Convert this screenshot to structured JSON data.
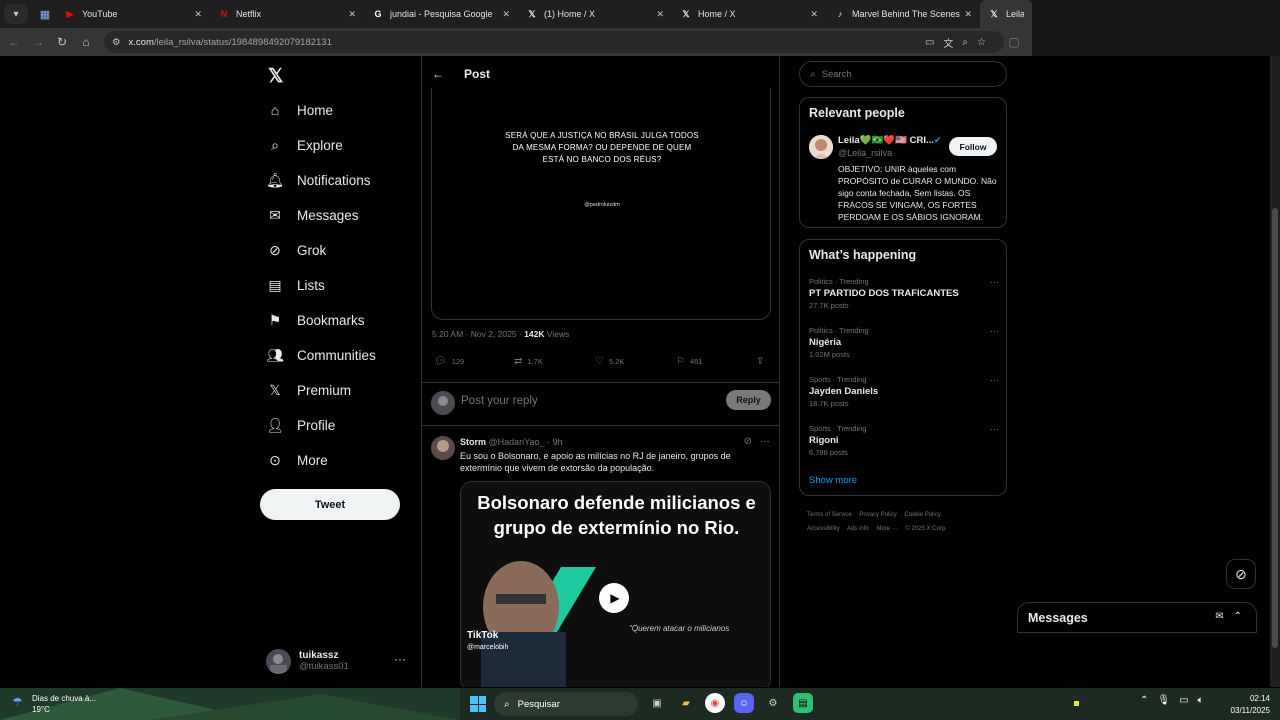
{
  "browser": {
    "tabs": [
      {
        "label": "YouTube",
        "favicon": "youtube-icon"
      },
      {
        "label": "Netflix",
        "favicon": "netflix-icon"
      },
      {
        "label": "jundiai - Pesquisa Google",
        "favicon": "google-icon"
      },
      {
        "label": "(1) Home / X",
        "favicon": "x-icon"
      },
      {
        "label": "Home / X",
        "favicon": "x-icon"
      },
      {
        "label": "Marvel Behind The Scenes: Le",
        "favicon": "tiktok-icon"
      },
      {
        "label": "Leila",
        "favicon": "x-icon"
      }
    ],
    "url_host": "x.com",
    "url_path": "/leila_rsilva/status/1984898492079182131"
  },
  "nav": {
    "items": [
      {
        "label": "Home",
        "icon": "home-icon"
      },
      {
        "label": "Explore",
        "icon": "search-icon"
      },
      {
        "label": "Notifications",
        "icon": "bell-icon"
      },
      {
        "label": "Messages",
        "icon": "mail-icon"
      },
      {
        "label": "Grok",
        "icon": "grok-icon"
      },
      {
        "label": "Lists",
        "icon": "list-icon"
      },
      {
        "label": "Bookmarks",
        "icon": "bookmark-icon"
      },
      {
        "label": "Communities",
        "icon": "people-icon"
      },
      {
        "label": "Premium",
        "icon": "x-icon"
      },
      {
        "label": "Profile",
        "icon": "person-icon"
      },
      {
        "label": "More",
        "icon": "more-circle-icon"
      }
    ],
    "tweet_button": "Tweet",
    "account": {
      "name": "tuikassz",
      "handle": "@tuikass01"
    }
  },
  "post": {
    "header_title": "Post",
    "image_text": "SERÁ QUE A JUSTIÇA NO BRASIL JULGA TODOS DA MESMA FORMA? OU DEPENDE DE QUEM ESTÁ NO BANCO DOS RÉUS?",
    "image_credit": "@pedroluizdm",
    "time": "5:20 AM · Nov 2, 2025 · ",
    "views_count": "142K",
    "views_label": " Views",
    "replies": "129",
    "reposts": "1.7K",
    "likes": "5.2K",
    "bookmarks": "461"
  },
  "reply_box": {
    "placeholder": "Post your reply",
    "button": "Reply"
  },
  "reply": {
    "name": "Storm",
    "handle": " @HadariYao_ · 9h",
    "text": "Eu sou o Bolsonaro, e apoio as milícias no RJ de janeiro, grupos de extermínio que vivem de extorsão da população.",
    "video_headline": "Bolsonaro defende milicianos e grupo de extermínio no Rio.",
    "video_quote": "\"Querem atacar o milicianos",
    "tiktok_label": "TikTok",
    "tiktok_user": "@marcelobih"
  },
  "sidebar": {
    "search_placeholder": "Search",
    "relevant_title": "Relevant people",
    "person": {
      "name": "Leila💚🇧🇷❤️🇺🇸 CRI...",
      "handle": "@Leila_rsilva",
      "follow": "Follow",
      "bio": "OBJETIVO: UNIR àqueles com PROPÓSITO de CURAR O MUNDO. Não sigo conta fechada, Sem listas. OS FRACOS SE VINGAM, OS FORTES PERDOAM E OS SÁBIOS IGNORAM."
    },
    "happening_title": "What’s happening",
    "trends": [
      {
        "category": "Politics · Trending",
        "title": "PT PARTIDO DOS TRAFICANTES",
        "count": "27.7K posts"
      },
      {
        "category": "Politics · Trending",
        "title": "Nigéria",
        "count": "1.02M posts"
      },
      {
        "category": "Sports · Trending",
        "title": "Jayden Daniels",
        "count": "18.7K posts"
      },
      {
        "category": "Sports · Trending",
        "title": "Rigoni",
        "count": "6,786 posts"
      }
    ],
    "show_more": "Show more",
    "footer": [
      "Terms of Service",
      "Privacy Policy",
      "Cookie Policy",
      "Accessibility",
      "Ads info",
      "More ···",
      "© 2025 X Corp."
    ]
  },
  "messages_drawer": {
    "title": "Messages"
  },
  "taskbar": {
    "weather_text": "Dias de chuva à...",
    "temperature": "19°C",
    "search_label": "Pesquisar",
    "time": "02:14",
    "date": "03/11/2025"
  }
}
